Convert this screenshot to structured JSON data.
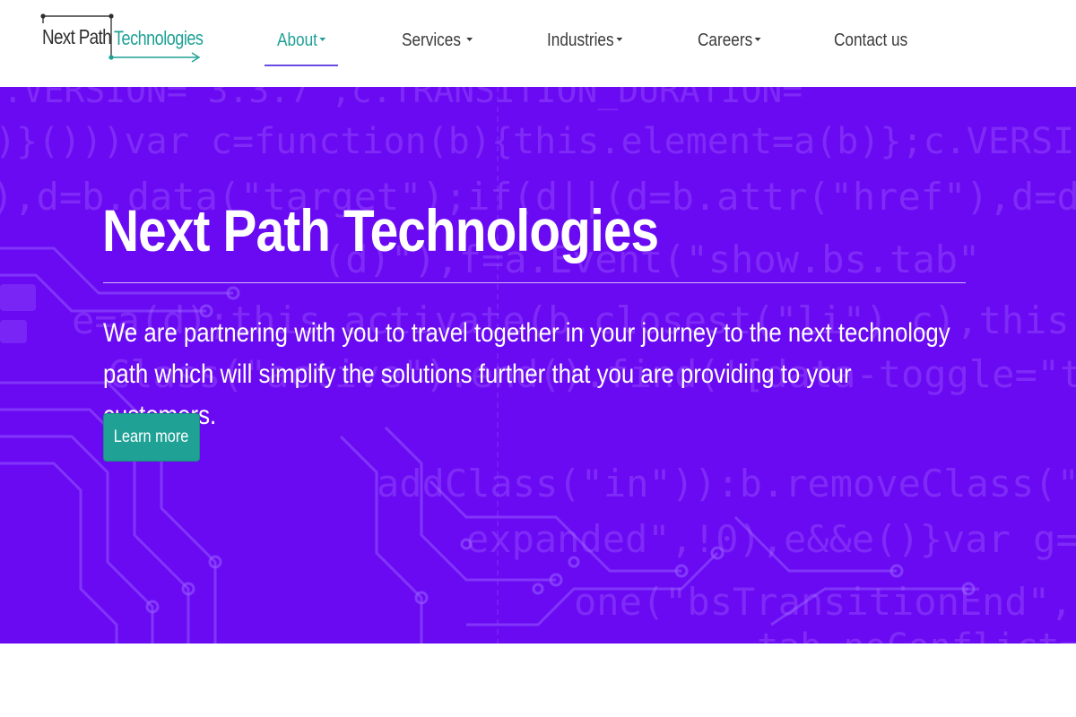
{
  "header": {
    "logo": {
      "word_1": "Next Path",
      "word_2": "Technologies"
    },
    "nav": [
      {
        "label": "About",
        "has_dropdown": true,
        "active": true
      },
      {
        "label": "Services",
        "has_dropdown": true,
        "active": false
      },
      {
        "label": "Industries",
        "has_dropdown": true,
        "active": false
      },
      {
        "label": "Careers",
        "has_dropdown": true,
        "active": false
      },
      {
        "label": "Contact us",
        "has_dropdown": false,
        "active": false
      }
    ]
  },
  "hero": {
    "title": "Next Path Technologies",
    "description": "We are partnering with you to travel together in your journey to the next technology path which will simplify the solutions further that you are providing to your customers.",
    "cta_label": "Learn more"
  },
  "colors": {
    "accent": "#1fa196",
    "hero_background": "#6a0af2",
    "nav_text": "#3a3a3a",
    "active_underline": "#6a4be0"
  }
}
